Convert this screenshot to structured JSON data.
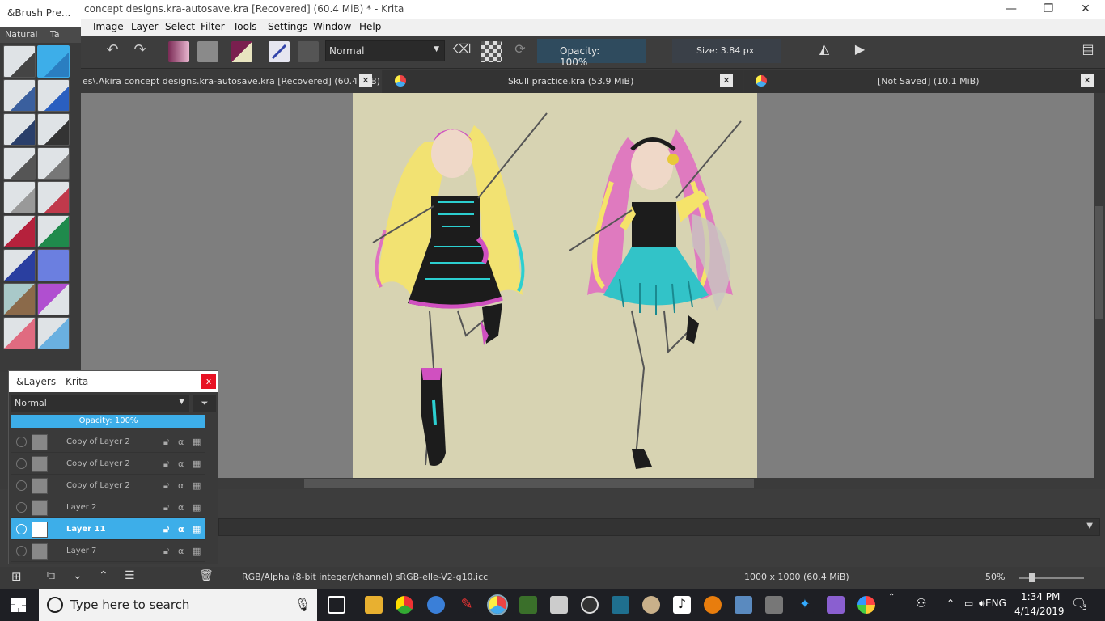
{
  "window": {
    "title": "concept designs.kra-autosave.kra [Recovered]  (60.4 MiB) * - Krita",
    "minimize": "—",
    "maximize": "❐",
    "close": "✕"
  },
  "menu": [
    "Image",
    "Layer",
    "Select",
    "Filter",
    "Tools",
    "Settings",
    "Window",
    "Help"
  ],
  "toolbar": {
    "blend_mode": "Normal",
    "opacity_label": "Opacity:  100%",
    "size_label": "Size:  3.84 px"
  },
  "brush_panel": {
    "title": "&Brush Pre...",
    "tab_natural": "Natural",
    "tab_tag": "Ta"
  },
  "tabs": [
    {
      "label": "es\\.Akira concept designs.kra-autosave.kra [Recovered]  (60.4 MiB)"
    },
    {
      "label": "Skull practice.kra  (53.9 MiB)"
    },
    {
      "label": "[Not Saved]  (10.1 MiB)"
    }
  ],
  "layers": {
    "title": "&Layers - Krita",
    "close": "x",
    "blend_mode": "Normal",
    "opacity": "Opacity:  100%",
    "rows": [
      {
        "name": "Copy of Layer 2"
      },
      {
        "name": "Copy of Layer 2"
      },
      {
        "name": "Copy of Layer 2"
      },
      {
        "name": "Layer 2"
      },
      {
        "name": "Layer 11"
      },
      {
        "name": "Layer 7"
      }
    ]
  },
  "status": {
    "color_space": "RGB/Alpha (8-bit integer/channel)  sRGB-elle-V2-g10.icc",
    "dimensions": "1000 x 1000 (60.4 MiB)",
    "zoom": "50%"
  },
  "taskbar": {
    "search_placeholder": "Type here to search",
    "lang": "ENG",
    "time": "1:34 PM",
    "date": "4/14/2019",
    "notif_count": "3"
  }
}
